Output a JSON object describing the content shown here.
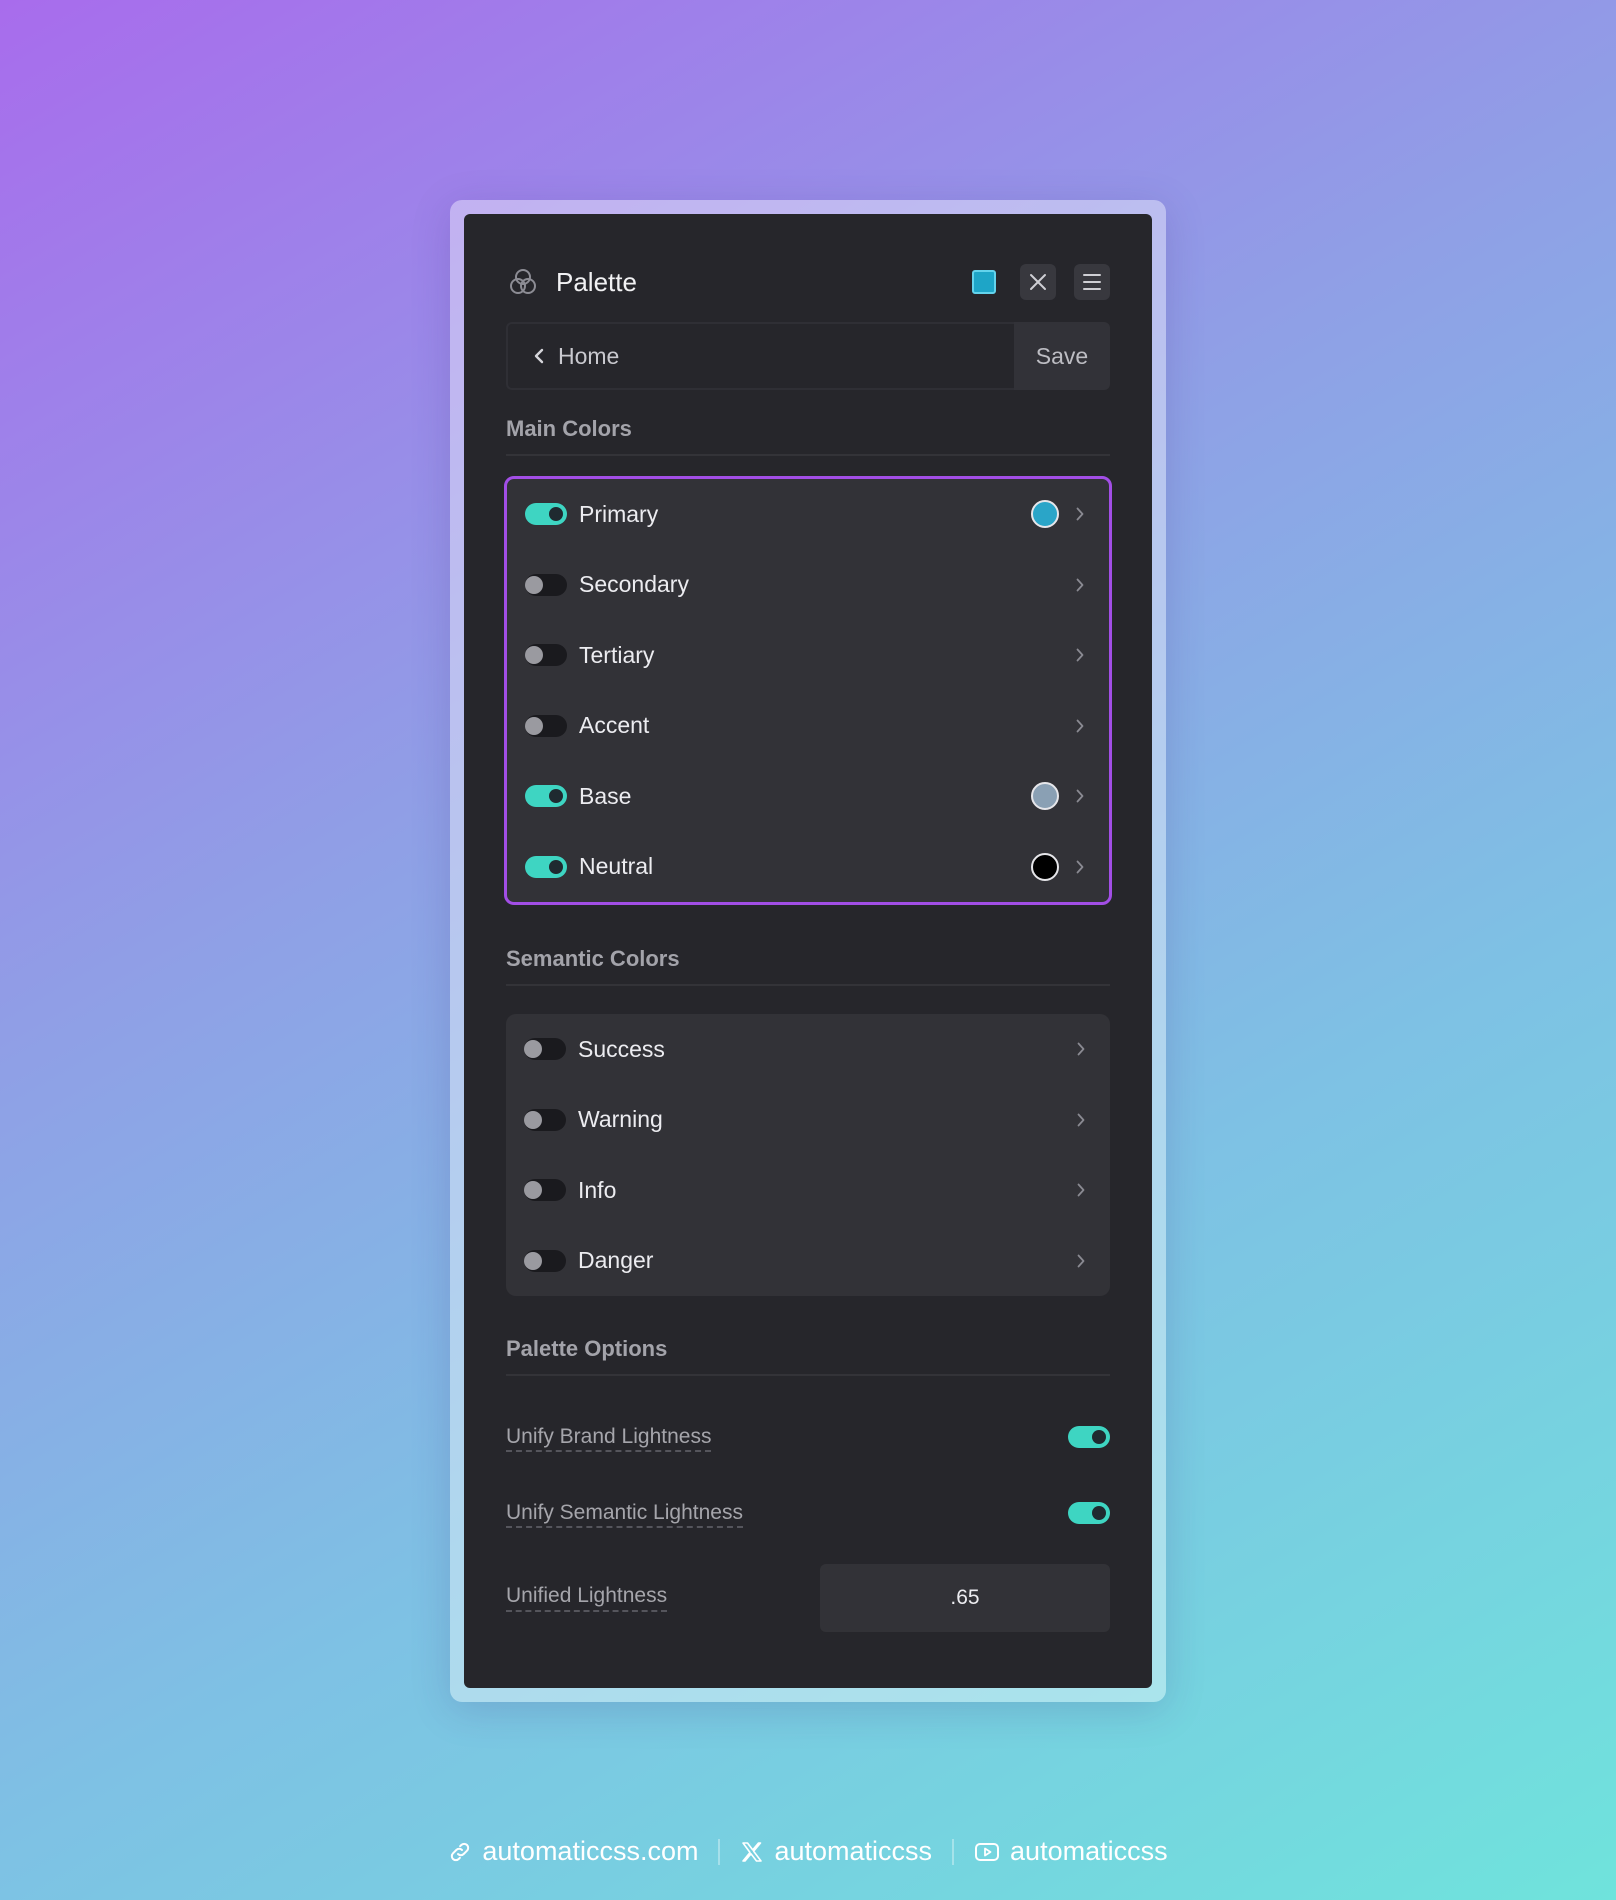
{
  "panel": {
    "title": "Palette",
    "nav": {
      "back_label": "Home",
      "save_label": "Save"
    }
  },
  "main_colors": {
    "heading": "Main Colors",
    "items": [
      {
        "label": "Primary",
        "enabled": true,
        "swatch": "#2aa5c8"
      },
      {
        "label": "Secondary",
        "enabled": false
      },
      {
        "label": "Tertiary",
        "enabled": false
      },
      {
        "label": "Accent",
        "enabled": false
      },
      {
        "label": "Base",
        "enabled": true,
        "swatch": "#8aa0b4"
      },
      {
        "label": "Neutral",
        "enabled": true,
        "swatch": "#000000"
      }
    ]
  },
  "semantic_colors": {
    "heading": "Semantic Colors",
    "items": [
      {
        "label": "Success",
        "enabled": false
      },
      {
        "label": "Warning",
        "enabled": false
      },
      {
        "label": "Info",
        "enabled": false
      },
      {
        "label": "Danger",
        "enabled": false
      }
    ]
  },
  "palette_options": {
    "heading": "Palette Options",
    "unify_brand": {
      "label": "Unify Brand Lightness",
      "enabled": true
    },
    "unify_semantic": {
      "label": "Unify Semantic Lightness",
      "enabled": true
    },
    "unified_lightness": {
      "label": "Unified Lightness",
      "value": ".65"
    }
  },
  "footer": {
    "website": "automaticcss.com",
    "x_handle": "automaticcss",
    "youtube_handle": "automaticcss"
  },
  "colors": {
    "accent": "#3ed5c2",
    "highlight_border": "#a24ee6",
    "panel_bg": "#26262b"
  }
}
